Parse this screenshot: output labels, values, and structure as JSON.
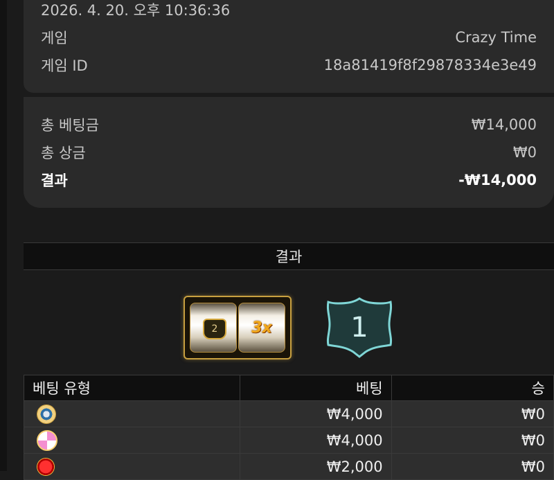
{
  "details": {
    "datetime": "2026. 4. 20. 오후 10:36:36",
    "game_label": "게임",
    "game_value": "Crazy Time",
    "game_id_label": "게임 ID",
    "game_id_value": "18a81419f8f29878334e3e49"
  },
  "summary": {
    "total_bet_label": "총 베팅금",
    "total_bet_value": "₩14,000",
    "total_win_label": "총 상금",
    "total_win_value": "₩0",
    "result_label": "결과",
    "result_value": "-₩14,000"
  },
  "result_section": {
    "title": "결과",
    "slot_left_number": "2",
    "slot_multiplier": "3x",
    "wheel_result": "1"
  },
  "bets_table": {
    "headers": [
      "베팅 유형",
      "베팅",
      "승"
    ],
    "rows": [
      {
        "icon": "coin-flip-icon",
        "bet": "₩4,000",
        "win": "₩0"
      },
      {
        "icon": "pachinko-icon",
        "bet": "₩4,000",
        "win": "₩0"
      },
      {
        "icon": "red-dot-icon",
        "bet": "₩2,000",
        "win": "₩0"
      }
    ]
  },
  "colors": {
    "background": "#1b1b1b",
    "card": "#2a2a2a",
    "gold": "#c8a040",
    "teal": "#2d6b6b"
  }
}
